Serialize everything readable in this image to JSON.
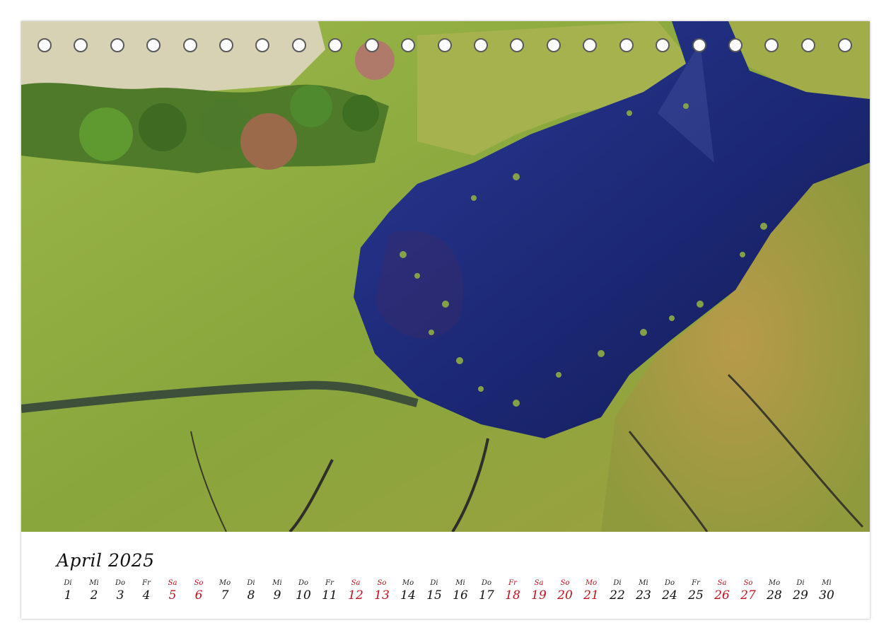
{
  "calendar": {
    "month_label": "April 2025",
    "days": [
      {
        "wd": "Di",
        "num": "1",
        "red": false
      },
      {
        "wd": "Mi",
        "num": "2",
        "red": false
      },
      {
        "wd": "Do",
        "num": "3",
        "red": false
      },
      {
        "wd": "Fr",
        "num": "4",
        "red": false
      },
      {
        "wd": "Sa",
        "num": "5",
        "red": true
      },
      {
        "wd": "So",
        "num": "6",
        "red": true
      },
      {
        "wd": "Mo",
        "num": "7",
        "red": false
      },
      {
        "wd": "Di",
        "num": "8",
        "red": false
      },
      {
        "wd": "Mi",
        "num": "9",
        "red": false
      },
      {
        "wd": "Do",
        "num": "10",
        "red": false
      },
      {
        "wd": "Fr",
        "num": "11",
        "red": false
      },
      {
        "wd": "Sa",
        "num": "12",
        "red": true
      },
      {
        "wd": "So",
        "num": "13",
        "red": true
      },
      {
        "wd": "Mo",
        "num": "14",
        "red": false
      },
      {
        "wd": "Di",
        "num": "15",
        "red": false
      },
      {
        "wd": "Mi",
        "num": "16",
        "red": false
      },
      {
        "wd": "Do",
        "num": "17",
        "red": false
      },
      {
        "wd": "Fr",
        "num": "18",
        "red": true
      },
      {
        "wd": "Sa",
        "num": "19",
        "red": true
      },
      {
        "wd": "So",
        "num": "20",
        "red": true
      },
      {
        "wd": "Mo",
        "num": "21",
        "red": true
      },
      {
        "wd": "Di",
        "num": "22",
        "red": false
      },
      {
        "wd": "Mi",
        "num": "23",
        "red": false
      },
      {
        "wd": "Do",
        "num": "24",
        "red": false
      },
      {
        "wd": "Fr",
        "num": "25",
        "red": false
      },
      {
        "wd": "Sa",
        "num": "26",
        "red": true
      },
      {
        "wd": "So",
        "num": "27",
        "red": true
      },
      {
        "wd": "Mo",
        "num": "28",
        "red": false
      },
      {
        "wd": "Di",
        "num": "29",
        "red": false
      },
      {
        "wd": "Mi",
        "num": "30",
        "red": false
      }
    ]
  },
  "colors": {
    "holiday_red": "#c0111c",
    "water": "#1c2a7a",
    "grass": "#8da842"
  }
}
